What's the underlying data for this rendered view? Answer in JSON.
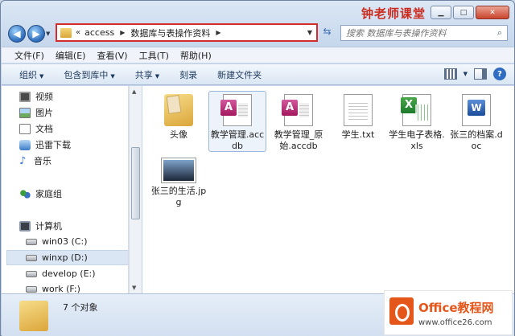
{
  "watermark": {
    "top_text": "钟老师课堂",
    "logo_brand": "Office教程网",
    "logo_site": "www.office26.com"
  },
  "window_controls": {
    "minimize": "▁",
    "maximize": "□",
    "close": "✕"
  },
  "nav": {
    "back": "◀",
    "forward": "▶",
    "dropdown": "▼",
    "refresh": "⇆"
  },
  "address": {
    "overflow": "«",
    "crumbs": [
      "access",
      "数据库与表操作资料"
    ],
    "separator": "▶",
    "dropdown": "▼"
  },
  "search": {
    "placeholder": "搜索 数据库与表操作资料",
    "icon": "search-icon"
  },
  "menubar": {
    "items": [
      "文件(F)",
      "编辑(E)",
      "查看(V)",
      "工具(T)",
      "帮助(H)"
    ]
  },
  "toolbar": {
    "organize": "组织",
    "include_library": "包含到库中",
    "share": "共享",
    "burn": "刻录",
    "new_folder": "新建文件夹",
    "caret": "▼",
    "help": "?"
  },
  "navpane": {
    "items": [
      {
        "label": "视频",
        "icon": "video-icon"
      },
      {
        "label": "图片",
        "icon": "picture-icon"
      },
      {
        "label": "文档",
        "icon": "document-icon"
      },
      {
        "label": "迅雷下载",
        "icon": "thunder-icon"
      },
      {
        "label": "音乐",
        "icon": "music-icon"
      },
      {
        "label": "家庭组",
        "icon": "homegroup-icon"
      },
      {
        "label": "计算机",
        "icon": "computer-icon"
      },
      {
        "label": "win03 (C:)",
        "icon": "drive-icon"
      },
      {
        "label": "winxp (D:)",
        "icon": "drive-icon"
      },
      {
        "label": "develop (E:)",
        "icon": "drive-icon"
      },
      {
        "label": "work (F:)",
        "icon": "drive-icon"
      }
    ]
  },
  "files": [
    {
      "name": "头像",
      "type": "folder"
    },
    {
      "name": "教学管理.accdb",
      "type": "access"
    },
    {
      "name": "教学管理_原始.accdb",
      "type": "access"
    },
    {
      "name": "学生.txt",
      "type": "txt"
    },
    {
      "name": "学生电子表格.xls",
      "type": "excel"
    },
    {
      "name": "张三的档案.doc",
      "type": "word"
    },
    {
      "name": "张三的生活.jpg",
      "type": "jpg"
    }
  ],
  "status": {
    "count_text": "7 个对象"
  }
}
